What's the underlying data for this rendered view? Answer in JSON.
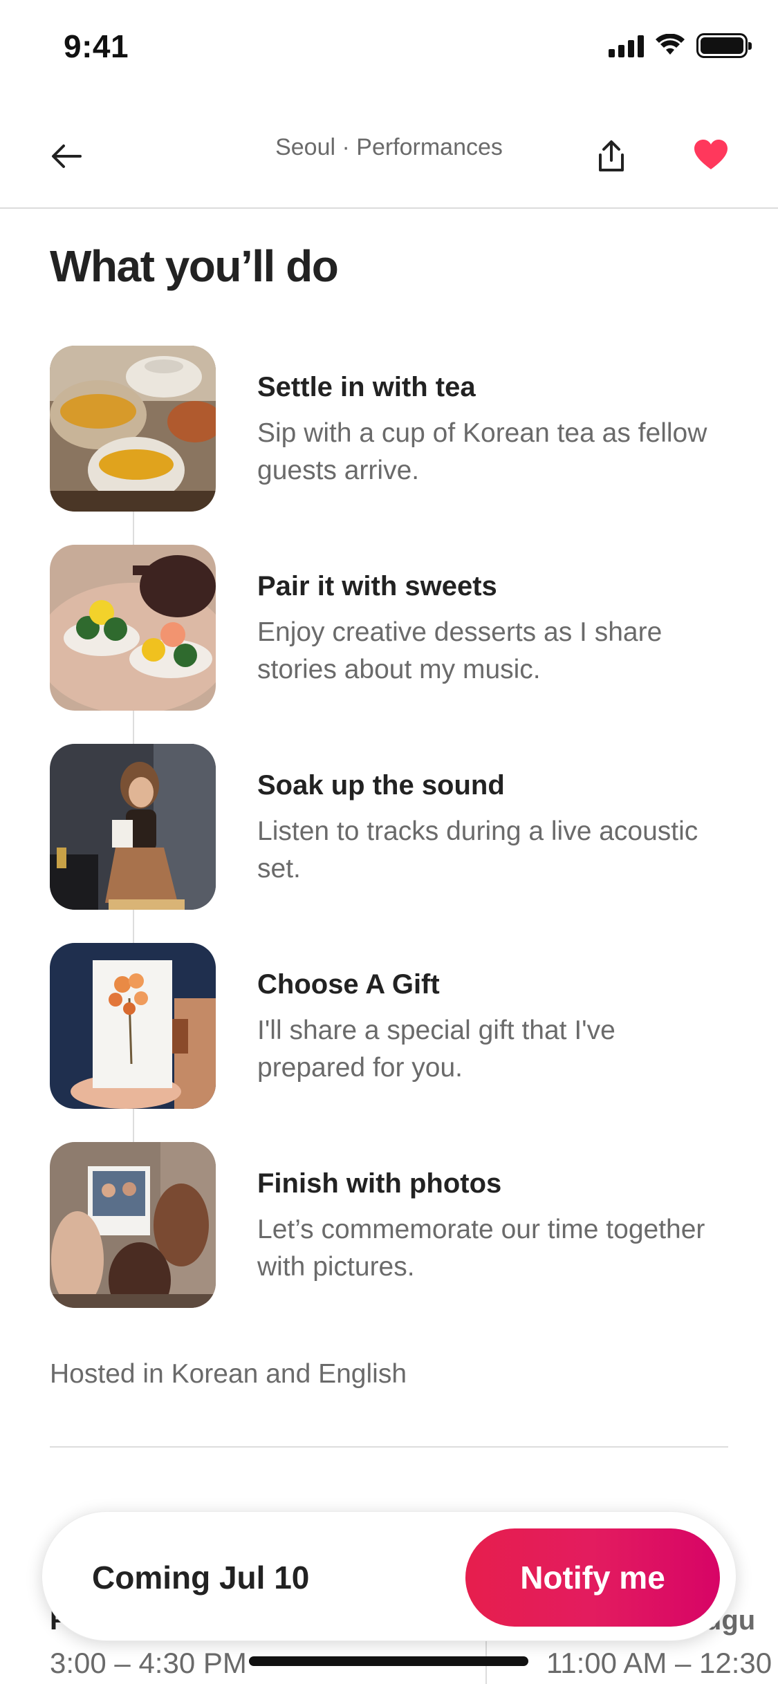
{
  "status_bar": {
    "time": "9:41",
    "icons": [
      "cellular-signal-icon",
      "wifi-icon",
      "battery-icon"
    ]
  },
  "nav": {
    "title": "Seoul · Performances",
    "icons": [
      "back-arrow-icon",
      "share-icon",
      "heart-icon"
    ],
    "favorite_color": "#ff385c"
  },
  "section": {
    "title": "What you’ll do"
  },
  "activities": [
    {
      "title": "Settle in with tea",
      "description": "Sip with a cup of Korean tea as fellow guests arrive."
    },
    {
      "title": "Pair it with sweets",
      "description": "Enjoy creative desserts as I share stories about my music."
    },
    {
      "title": "Soak up the sound",
      "description": "Listen to tracks during a live acoustic set."
    },
    {
      "title": "Choose A Gift",
      "description": "I'll share a special gift that I've prepared for you."
    },
    {
      "title": "Finish with photos",
      "description": "Let’s commemorate our time together with pictures."
    }
  ],
  "hosted_language": "Hosted in Korean and English",
  "availability": {
    "slots": [
      {
        "day": "F",
        "time": "3:00 – 4:30 PM"
      },
      {
        "day": "Augu",
        "time": "11:00 AM – 12:30"
      }
    ]
  },
  "footer_bar": {
    "label": "Coming Jul 10",
    "button_label": "Notify me",
    "button_color": "#e31c5f"
  }
}
